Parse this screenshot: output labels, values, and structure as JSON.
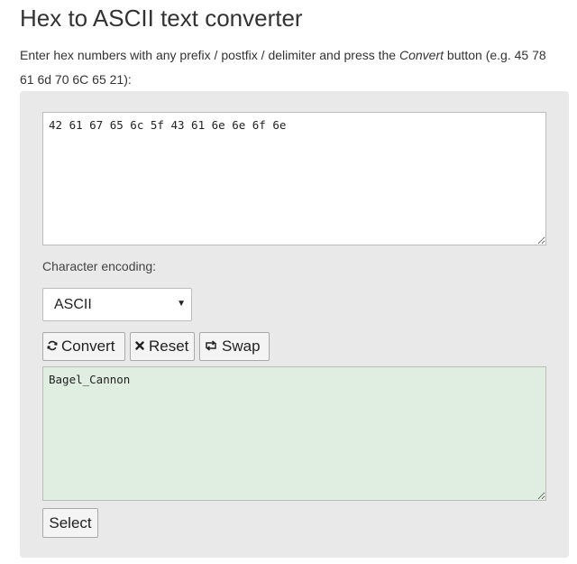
{
  "page": {
    "title": "Hex to ASCII text converter",
    "description_before": "Enter hex numbers with any prefix / postfix / delimiter and press the ",
    "description_emphasis": "Convert",
    "description_after": " button (e.g. 45 78 61 6d 70 6C 65 21):"
  },
  "converter": {
    "hex_input_value": "42 61 67 65 6c 5f 43 61 6e 6e 6f 6e",
    "encoding_label": "Character encoding:",
    "encoding_selected": "ASCII",
    "convert_label": "Convert",
    "reset_label": "Reset",
    "swap_label": "Swap",
    "output_value": "Bagel_Cannon",
    "select_label": "Select"
  },
  "icons": {
    "convert": "refresh-icon",
    "reset": "close-icon",
    "swap": "swap-icon",
    "dropdown": "caret-down-icon"
  },
  "colors": {
    "panel_bg": "#e9e9e9",
    "output_bg": "#dfeee0",
    "button_bg": "#f4f4f4"
  }
}
